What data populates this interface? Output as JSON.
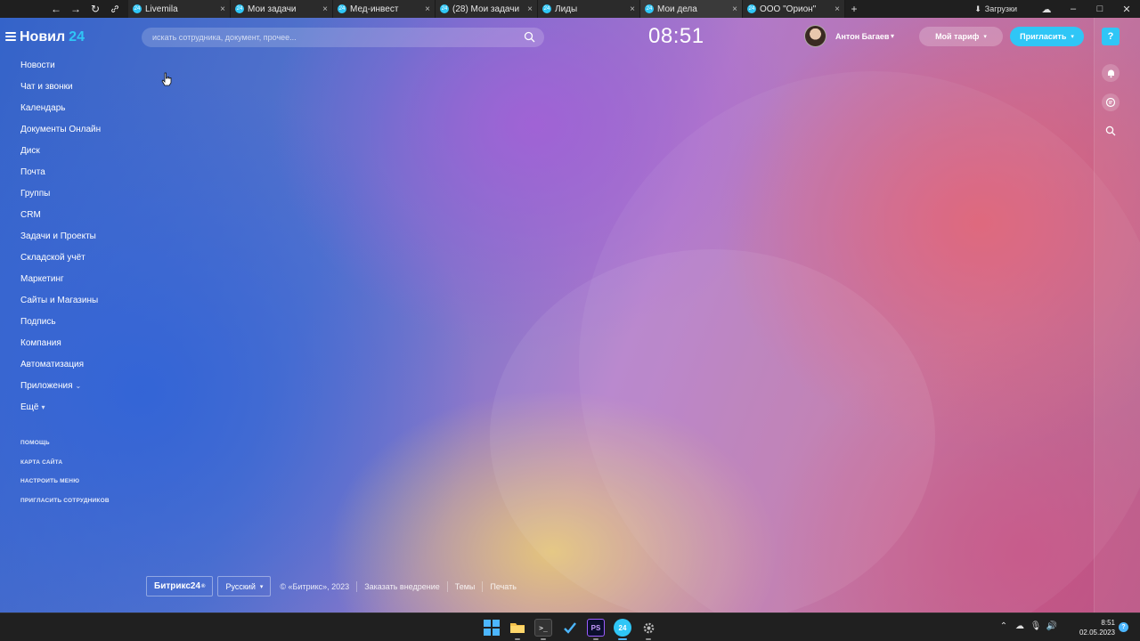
{
  "browser": {
    "nav": {
      "back": "←",
      "forward": "→",
      "reload": "↻",
      "link": "🔗"
    },
    "tabs": [
      {
        "title": "Livemila",
        "favicon": "24",
        "active": false
      },
      {
        "title": "Мои задачи",
        "favicon": "24",
        "active": false
      },
      {
        "title": "Мед-инвест",
        "favicon": "24",
        "active": false
      },
      {
        "title": "(28) Мои задачи",
        "favicon": "24",
        "active": false
      },
      {
        "title": "Лиды",
        "favicon": "24",
        "active": false
      },
      {
        "title": "Мои дела",
        "favicon": "24",
        "active": true
      },
      {
        "title": "ООО \"Орион\"",
        "favicon": "24",
        "active": false
      }
    ],
    "close_glyph": "×",
    "new_tab": "+",
    "downloads_label": "Загрузки"
  },
  "header": {
    "logo_name": "Новил",
    "logo_number": "24",
    "search_placeholder": "искать сотрудника, документ, прочее...",
    "clock": "08:51",
    "user_name": "Антон Багаев",
    "tariff_button": "Мой тариф",
    "invite_button": "Пригласить",
    "help_glyph": "?",
    "caret": "▾"
  },
  "menu": {
    "items": [
      {
        "label": "Новости",
        "caret": ""
      },
      {
        "label": "Чат и звонки",
        "caret": ""
      },
      {
        "label": "Календарь",
        "caret": ""
      },
      {
        "label": "Документы Онлайн",
        "caret": ""
      },
      {
        "label": "Диск",
        "caret": ""
      },
      {
        "label": "Почта",
        "caret": ""
      },
      {
        "label": "Группы",
        "caret": ""
      },
      {
        "label": "CRM",
        "caret": ""
      },
      {
        "label": "Задачи и Проекты",
        "caret": ""
      },
      {
        "label": "Складской учёт",
        "caret": ""
      },
      {
        "label": "Маркетинг",
        "caret": ""
      },
      {
        "label": "Сайты и Магазины",
        "caret": ""
      },
      {
        "label": "Подпись",
        "caret": ""
      },
      {
        "label": "Компания",
        "caret": ""
      },
      {
        "label": "Автоматизация",
        "caret": ""
      },
      {
        "label": "Приложения",
        "caret": "⌄"
      },
      {
        "label": "Ещё",
        "caret": "▾"
      }
    ],
    "secondary": [
      {
        "label": "Помощь"
      },
      {
        "label": "Карта сайта"
      },
      {
        "label": "Настроить меню"
      },
      {
        "label": "Пригласить сотрудников"
      }
    ]
  },
  "footer": {
    "brand": "Битрикс24",
    "brand_mark": "®",
    "language": "Русский",
    "copyright": "© «Битрикс», 2023",
    "links": [
      "Заказать внедрение",
      "Темы",
      "Печать"
    ]
  },
  "taskbar": {
    "terminal_glyph": ">_",
    "ps_label": "PS",
    "b24_label": "24",
    "time": "8:51",
    "date": "02.05.2023",
    "badge": "?"
  },
  "colors": {
    "accent": "#2fc6f6",
    "tab_bg": "#2b2b2b",
    "taskbar_bg": "#202020"
  },
  "icons": {
    "search": "search-icon",
    "bell": "bell-icon",
    "chat": "chat-icon",
    "find": "search-icon",
    "downloads": "download-icon",
    "cloud": "cloud-icon"
  }
}
